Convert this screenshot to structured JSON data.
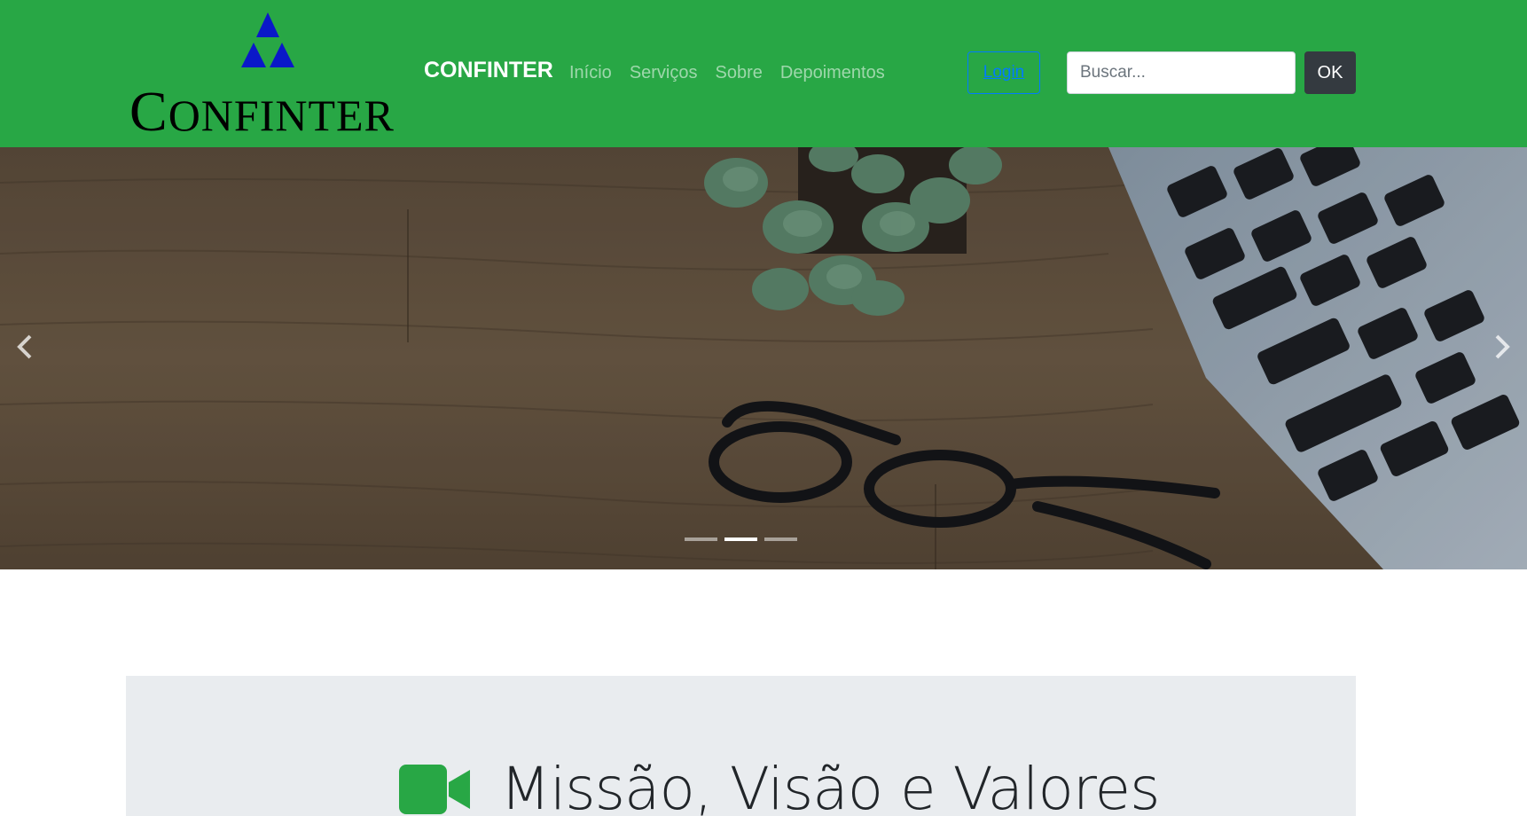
{
  "header": {
    "logo_text": "CONFINTER",
    "logo_icon": "triforce-logo-icon",
    "brand": "CONFINTER",
    "nav": [
      {
        "label": "Início"
      },
      {
        "label": "Serviços"
      },
      {
        "label": "Sobre"
      },
      {
        "label": "Depoimentos"
      }
    ],
    "login_label": "Login",
    "search_placeholder": "Buscar...",
    "search_value": "",
    "ok_label": "OK"
  },
  "carousel": {
    "prev_icon": "chevron-left-icon",
    "next_icon": "chevron-right-icon",
    "slide_count": 3,
    "active_index": 1
  },
  "section": {
    "icon": "video-camera-icon",
    "title": "Missão, Visão e Valores"
  },
  "colors": {
    "navbar": "#28a745",
    "accent": "#007bff",
    "dark_button": "#343a40",
    "section_bg": "#e9ecef",
    "icon_green": "#28a745"
  }
}
